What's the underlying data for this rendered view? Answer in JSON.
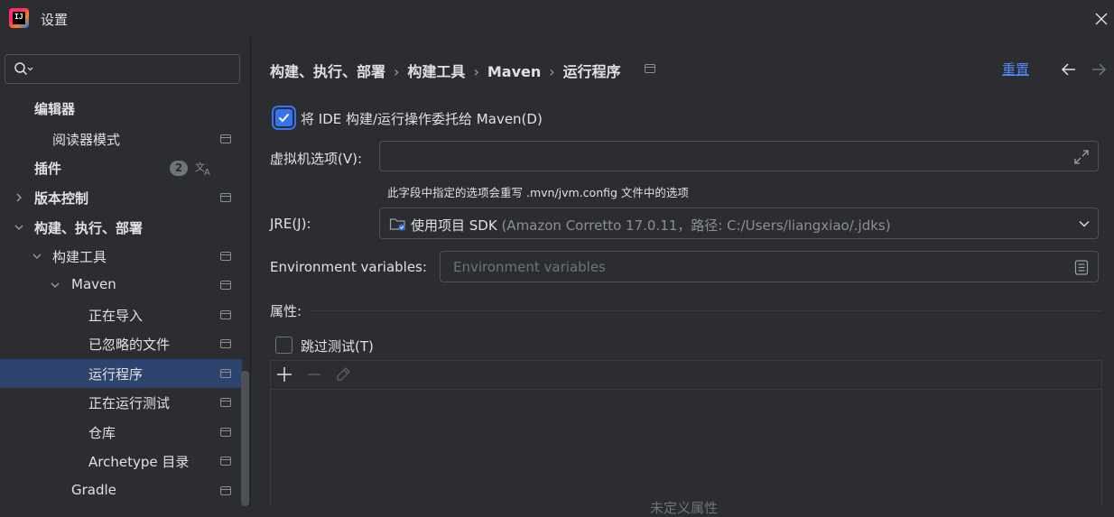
{
  "window": {
    "title": "设置",
    "logo_text": "IJ"
  },
  "sidebar": {
    "search": {
      "value": "",
      "placeholder": ""
    },
    "items": [
      {
        "label": "编辑器",
        "bold": true
      },
      {
        "label": "阅读器模式"
      },
      {
        "label": "插件",
        "bold": true,
        "badge": "2"
      },
      {
        "label": "版本控制",
        "bold": true,
        "expanded": false
      },
      {
        "label": "构建、执行、部署",
        "bold": true,
        "expanded": true
      },
      {
        "label": "构建工具",
        "expanded": true
      },
      {
        "label": "Maven",
        "expanded": true
      },
      {
        "label": "正在导入"
      },
      {
        "label": "已忽略的文件"
      },
      {
        "label": "运行程序",
        "selected": true
      },
      {
        "label": "正在运行测试"
      },
      {
        "label": "仓库"
      },
      {
        "label": "Archetype 目录"
      },
      {
        "label": "Gradle"
      }
    ]
  },
  "breadcrumb": {
    "items": [
      "构建、执行、部署",
      "构建工具",
      "Maven",
      "运行程序"
    ],
    "separator": "›"
  },
  "header": {
    "reset_label": "重置"
  },
  "settings": {
    "delegate": {
      "label": "将 IDE 构建/运行操作委托给 Maven(D)",
      "checked": true
    },
    "vm_options": {
      "label": "虚拟机选项(V):",
      "value": "",
      "hint": "此字段中指定的选项会重写 .mvn/jvm.config 文件中的选项"
    },
    "jre": {
      "label": "JRE(J):",
      "selected_main": "使用项目 SDK",
      "selected_detail": " (Amazon Corretto 17.0.11，路径: C:/Users/liangxiao/.jdks)"
    },
    "env_vars": {
      "label": "Environment variables:",
      "value": "",
      "placeholder": "Environment variables"
    },
    "properties": {
      "group_label": "属性:",
      "skip_tests": {
        "label": "跳过测试(T)",
        "checked": false
      },
      "empty_text": "未定义属性"
    }
  },
  "colors": {
    "accent": "#3574f0",
    "link": "#548af7",
    "selection": "#2e436e",
    "background": "#2b2d30"
  }
}
